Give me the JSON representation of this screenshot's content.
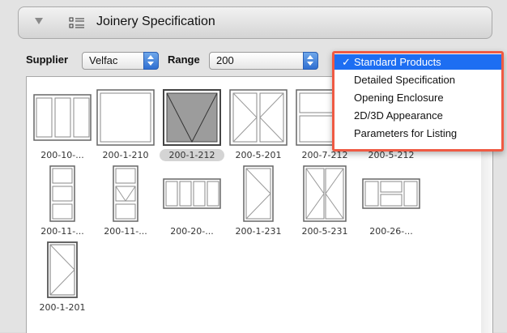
{
  "header": {
    "title": "Joinery Specification"
  },
  "toolbar": {
    "supplier_label": "Supplier",
    "supplier_value": "Velfac",
    "range_label": "Range",
    "range_value": "200"
  },
  "items": [
    "200-10-...",
    "200-1-210",
    "200-1-212",
    "200-5-201",
    "200-7-212",
    "200-5-212",
    "200-11-...",
    "200-11-...",
    "200-20-...",
    "200-1-231",
    "200-5-231",
    "200-26-...",
    "200-1-201"
  ],
  "menu": {
    "check": "✓",
    "options": [
      "Standard Products",
      "Detailed Specification",
      "Opening Enclosure",
      "2D/3D Appearance",
      "Parameters for Listing"
    ]
  },
  "colors": {
    "highlight": "#1d6ef2",
    "callout": "#ef5a43"
  }
}
